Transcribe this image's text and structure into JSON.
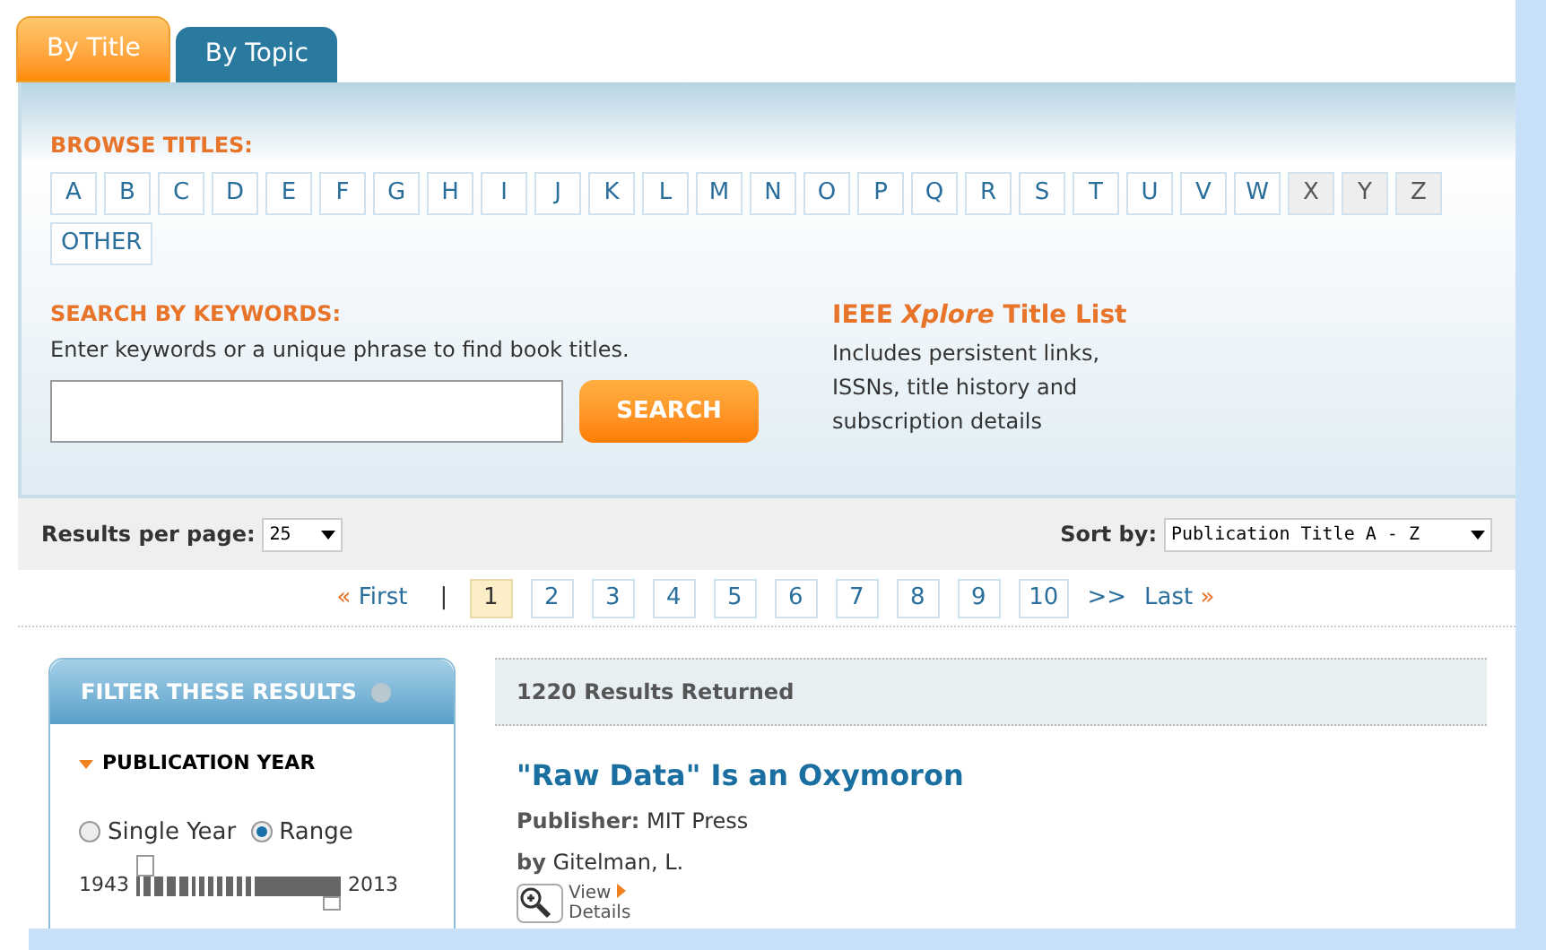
{
  "tabs": [
    {
      "label": "By Title",
      "selected": true
    },
    {
      "label": "By Topic",
      "selected": false
    }
  ],
  "browse": {
    "heading": "BROWSE TITLES:",
    "letters": [
      {
        "label": "A",
        "disabled": false
      },
      {
        "label": "B",
        "disabled": false
      },
      {
        "label": "C",
        "disabled": false
      },
      {
        "label": "D",
        "disabled": false
      },
      {
        "label": "E",
        "disabled": false
      },
      {
        "label": "F",
        "disabled": false
      },
      {
        "label": "G",
        "disabled": false
      },
      {
        "label": "H",
        "disabled": false
      },
      {
        "label": "I",
        "disabled": false
      },
      {
        "label": "J",
        "disabled": false
      },
      {
        "label": "K",
        "disabled": false
      },
      {
        "label": "L",
        "disabled": false
      },
      {
        "label": "M",
        "disabled": false
      },
      {
        "label": "N",
        "disabled": false
      },
      {
        "label": "O",
        "disabled": false
      },
      {
        "label": "P",
        "disabled": false
      },
      {
        "label": "Q",
        "disabled": false
      },
      {
        "label": "R",
        "disabled": false
      },
      {
        "label": "S",
        "disabled": false
      },
      {
        "label": "T",
        "disabled": false
      },
      {
        "label": "U",
        "disabled": false
      },
      {
        "label": "V",
        "disabled": false
      },
      {
        "label": "W",
        "disabled": false
      },
      {
        "label": "X",
        "disabled": true
      },
      {
        "label": "Y",
        "disabled": true
      },
      {
        "label": "Z",
        "disabled": true
      },
      {
        "label": "OTHER",
        "disabled": false
      }
    ]
  },
  "search": {
    "heading": "SEARCH BY KEYWORDS:",
    "hint": "Enter keywords or a unique phrase to find book titles.",
    "button": "SEARCH"
  },
  "title_list": {
    "title": "IEEE *Xplore* Title List",
    "description": "Includes persistent links, ISSNs, title history and subscription details"
  },
  "results_bar": {
    "per_page_label": "Results per page:",
    "per_page_value": "25",
    "sort_label": "Sort by:",
    "sort_value": "Publication Title A - Z"
  },
  "pagination": {
    "first": "« First",
    "separator": "|",
    "pages": [
      {
        "label": "1",
        "selected": true
      },
      {
        "label": "2",
        "selected": false
      },
      {
        "label": "3",
        "selected": false
      },
      {
        "label": "4",
        "selected": false
      },
      {
        "label": "5",
        "selected": false
      },
      {
        "label": "6",
        "selected": false
      },
      {
        "label": "7",
        "selected": false
      },
      {
        "label": "8",
        "selected": false
      },
      {
        "label": "9",
        "selected": false
      },
      {
        "label": "10",
        "selected": false
      }
    ],
    "next": ">>",
    "last": "Last »"
  },
  "filter": {
    "title": "FILTER THESE RESULTS",
    "section": "PUBLICATION YEAR",
    "modes": [
      {
        "label": "Single Year",
        "selected": false
      },
      {
        "label": "Range",
        "selected": true
      }
    ],
    "min_label": "1943",
    "max_label": "2013",
    "range_start": {
      "level": 0
    },
    "range_end": {
      "level": 1
    }
  },
  "results": {
    "count": "1220 Results Returned",
    "items": [
      {
        "title": "\"Raw Data\" Is an Oxymoron",
        "publisher_label": "Publisher:",
        "publisher": "MIT Press",
        "author_label": "by",
        "author": "Gitelman, L.",
        "view": "View",
        "details": "Details"
      }
    ]
  }
}
